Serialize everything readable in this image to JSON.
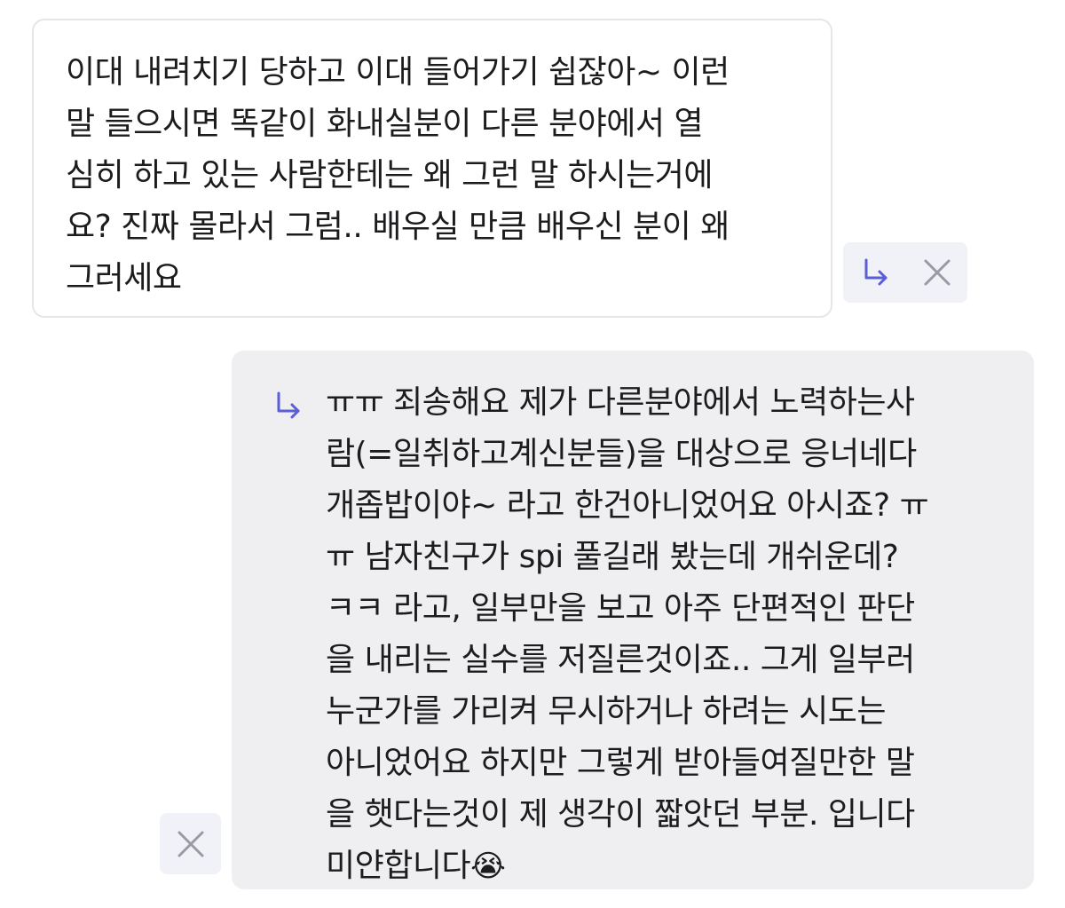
{
  "messages": {
    "question": {
      "lines": [
        "이대 내려치기 당하고 이대 들어가기 쉽잖아~ 이런",
        "말 들으시면 똑같이 화내실분이 다른 분야에서 열",
        "심히 하고 있는 사람한테는 왜 그런 말 하시는거에",
        "요? 진짜 몰라서 그럼.. 배우실 만큼 배우신 분이 왜",
        "그러세요"
      ]
    },
    "answer": {
      "lines": [
        "ㅠㅠ 죄송해요 제가 다른분야에서 노력하는사",
        "람(=일취하고계신분들)을 대상으로 응너네다",
        "개좁밥이야~ 라고 한건아니었어요 아시죠? ㅠ",
        "ㅠ 남자친구가 spi 풀길래 봤는데 개쉬운데?",
        "ㅋㅋ 라고, 일부만을 보고 아주 단편적인 판단",
        "을 내리는 실수를 저질른것이죠.. 그게 일부러",
        "누군가를 가리켜 무시하거나 하려는 시도는",
        "아니었어요 하지만 그렇게 받아들여질만한 말",
        "을 햇다는것이 제 생각이 짧앗던 부분. 입니다",
        "미얀합니다"
      ],
      "trailing_emoji": "😭"
    }
  },
  "icons": {
    "reply": "reply-arrow-icon",
    "close": "close-icon"
  },
  "colors": {
    "accent": "#5a5fd6",
    "icon_gray": "#9a9aa6",
    "answer_bubble_bg": "#efeff1",
    "action_bg": "#f1f1f8",
    "text": "#1c1c1e"
  }
}
